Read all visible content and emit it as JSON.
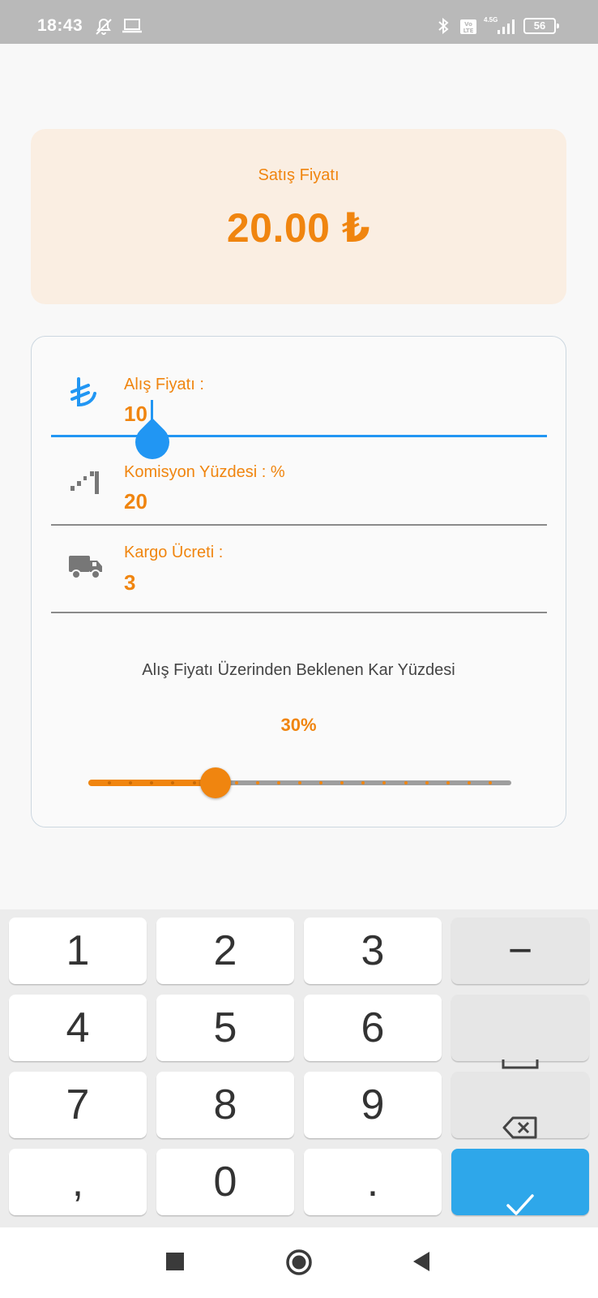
{
  "status_bar": {
    "time": "18:43",
    "network": "4.5G",
    "battery": "56"
  },
  "price_card": {
    "label": "Satış Fiyatı",
    "value": "20.00 ₺"
  },
  "form": {
    "purchase_price": {
      "label": "Alış Fiyatı :",
      "value": "10",
      "icon": "lira-icon"
    },
    "commission": {
      "label": "Komisyon Yüzdesi : %",
      "value": "20",
      "icon": "percentage-icon"
    },
    "shipping": {
      "label": "Kargo Ücreti :",
      "value": "3",
      "icon": "truck-icon"
    },
    "profit_title": "Alış Fiyatı Üzerinden Beklenen Kar Yüzdesi",
    "profit_value": "30%",
    "profit_slider": {
      "value": 30,
      "min": 0,
      "max": 100
    }
  },
  "keyboard": {
    "rows": [
      [
        "1",
        "2",
        "3",
        "−"
      ],
      [
        "4",
        "5",
        "6",
        "space"
      ],
      [
        "7",
        "8",
        "9",
        "backspace"
      ],
      [
        ",",
        "0",
        ".",
        "done"
      ]
    ]
  },
  "colors": {
    "accent": "#f0850f",
    "focus": "#2196f3",
    "card_bg": "#faeee2",
    "done_key": "#2ea7ea"
  }
}
